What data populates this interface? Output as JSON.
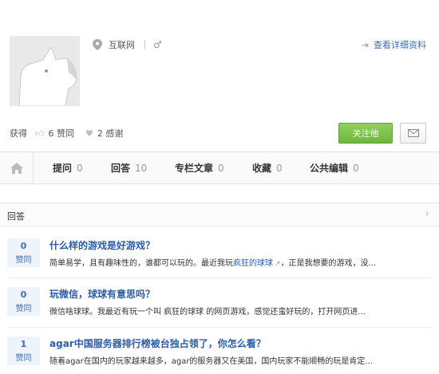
{
  "profile": {
    "location": "互联网",
    "gender_icon": "male-icon",
    "detail_link": "查看详细资料",
    "stats_prefix": "获得",
    "upvotes": "6 赞同",
    "thanks": "2 感谢",
    "follow_button": "关注他",
    "accent_color": "#6eb63b"
  },
  "tabs": [
    {
      "label": "提问",
      "count": "0"
    },
    {
      "label": "回答",
      "count": "10"
    },
    {
      "label": "专栏文章",
      "count": "0"
    },
    {
      "label": "收藏",
      "count": "0"
    },
    {
      "label": "公共编辑",
      "count": "0"
    }
  ],
  "section": {
    "title": "回答"
  },
  "answers": [
    {
      "votes": "0",
      "vote_label": "赞同",
      "title": "什么样的游戏是好游戏？",
      "excerpt_before": "简单易学，且有趣味性的，谁都可以玩的。最近我玩",
      "excerpt_link": "疯狂的球球",
      "excerpt_after": "，正是我想要的游戏，没..."
    },
    {
      "votes": "0",
      "vote_label": "赞同",
      "title": "玩微信，球球有意思吗？",
      "excerpt": "微信啥球球。我最近有玩一个叫 疯狂的球球 的网页游戏，感觉还蛮好玩的，打开网页进..."
    },
    {
      "votes": "1",
      "vote_label": "赞同",
      "title": "agar中国服务器排行榜被台独占领了，你怎么看？",
      "excerpt": "随着agar在国内的玩家越来越多，agar的服务器又在美国，国内玩家不能顺畅的玩是肯定..."
    }
  ]
}
